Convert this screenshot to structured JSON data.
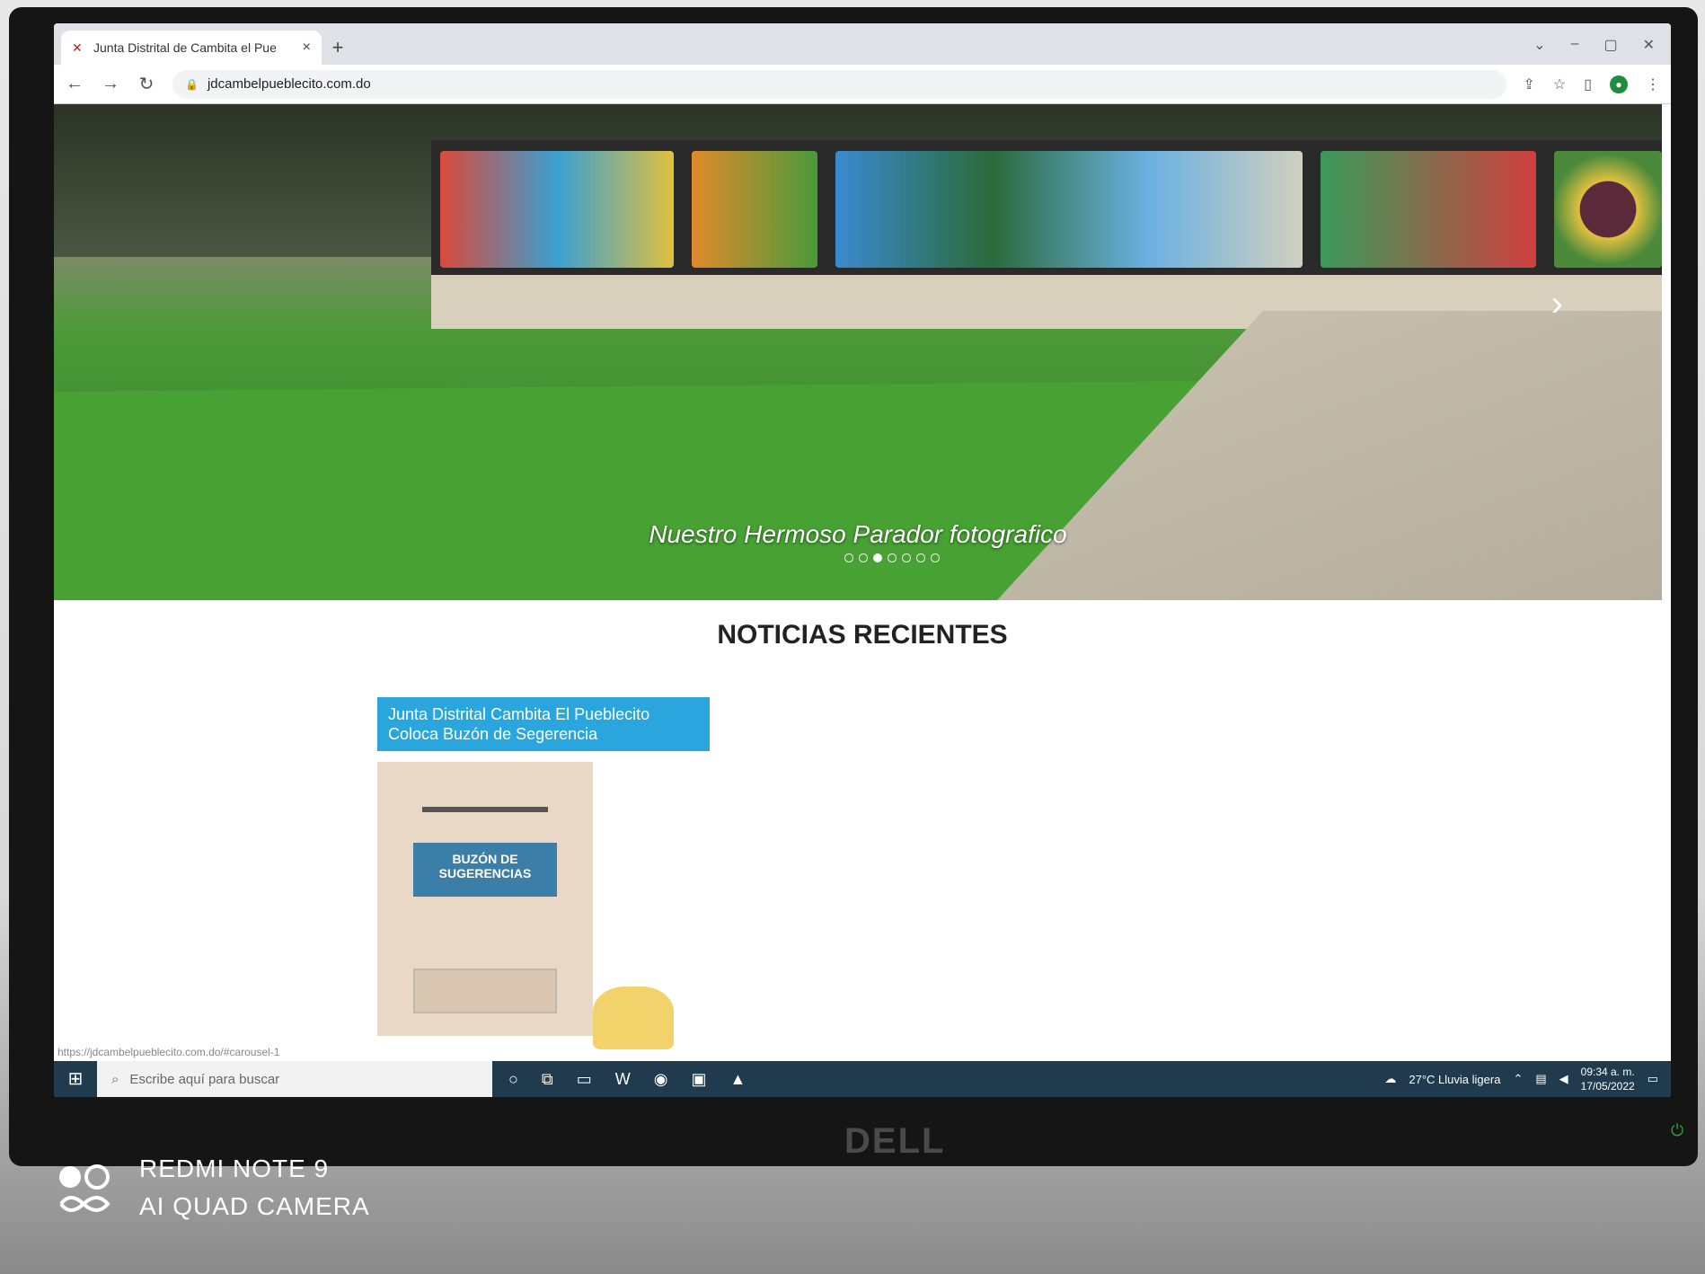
{
  "browser": {
    "tab_title": "Junta Distrital de Cambita el Pue",
    "tab_close": "×",
    "new_tab": "+",
    "url": "jdcambelpueblecito.com.do",
    "status_url": "https://jdcambelpueblecito.com.do/#carousel-1"
  },
  "hero": {
    "caption": "Nuestro Hermoso Parador fotografico",
    "slide_count": 7,
    "active_slide": 3
  },
  "news": {
    "section_title": "NOTICIAS RECIENTES",
    "items": [
      {
        "title": "Junta Distrital Cambita El Pueblecito Coloca Buzón de Segerencia",
        "image_label": "BUZÓN DE SUGERENCIAS"
      }
    ]
  },
  "taskbar": {
    "search_placeholder": "Escribe aquí para buscar",
    "weather": "27°C  Lluvia ligera",
    "time": "09:34 a. m.",
    "date": "17/05/2022"
  },
  "monitor": {
    "brand": "DELL"
  },
  "camera_watermark": {
    "line1": "REDMI NOTE 9",
    "line2": "AI QUAD CAMERA"
  },
  "colors": {
    "news_title_bg": "#2aa5dd",
    "taskbar_bg": "#1f3b4d"
  }
}
